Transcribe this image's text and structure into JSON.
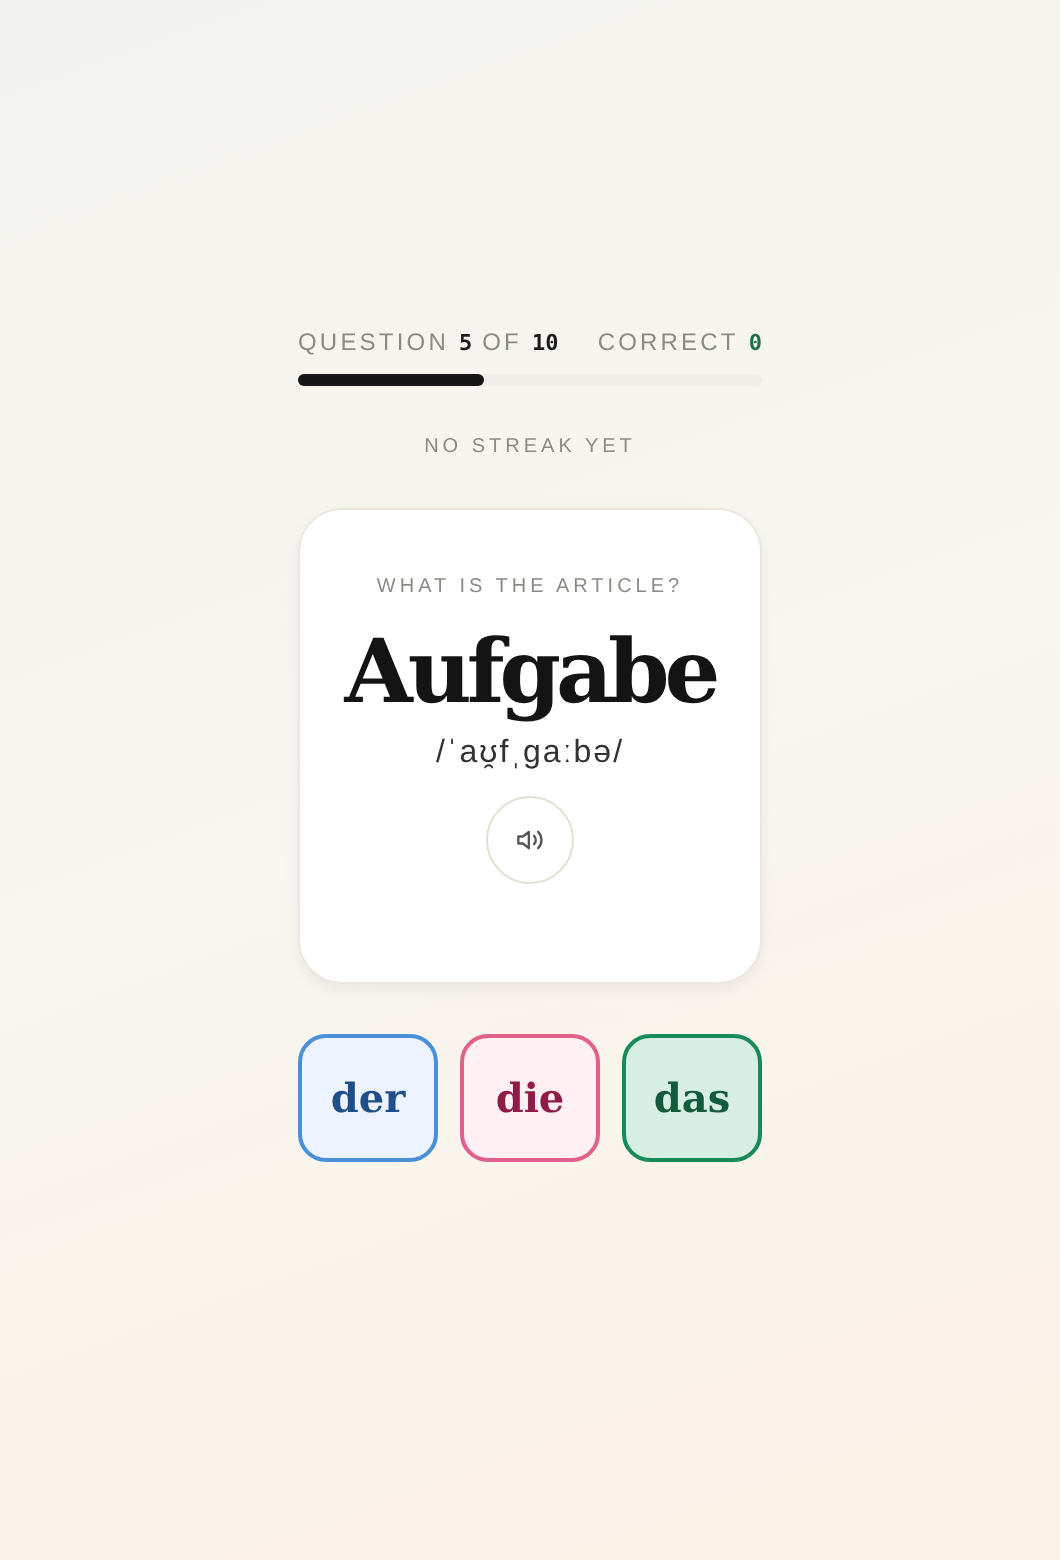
{
  "progress": {
    "question_label": "QUESTION",
    "question_number": "5",
    "of_label": "OF",
    "total": "10",
    "correct_label": "CORRECT",
    "correct_count": "0",
    "level": 0.4
  },
  "streak": "NO STREAK YET",
  "card": {
    "prompt": "WHAT IS THE ARTICLE?",
    "word": "Aufgabe",
    "pronunciation": "/ˈaʊ̯fˌɡaːbə/"
  },
  "answers": [
    {
      "label": "der",
      "kind": "masculine"
    },
    {
      "label": "die",
      "kind": "feminine"
    },
    {
      "label": "das",
      "kind": "neuter"
    }
  ]
}
